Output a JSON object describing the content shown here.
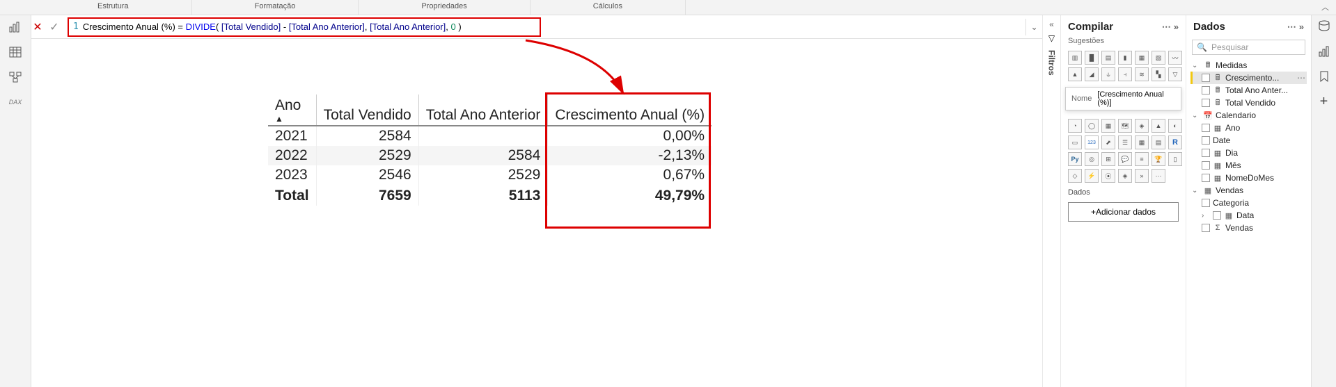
{
  "ribbon": {
    "tabs": [
      "Estrutura",
      "Formatação",
      "Propriedades",
      "Cálculos"
    ]
  },
  "formula": {
    "line_no": "1",
    "measure_name": "Crescimento Anual (%)",
    "eq": " = ",
    "fn": "DIVIDE",
    "open": "( ",
    "col1": "[Total Vendido]",
    "minus": " - ",
    "col2": "[Total Ano Anterior]",
    "comma1": ", ",
    "col3": "[Total Ano Anterior]",
    "comma2": ", ",
    "zero": "0",
    "close": " )"
  },
  "chart_data": {
    "type": "table",
    "columns": [
      "Ano",
      "Total Vendido",
      "Total Ano Anterior",
      "Crescimento Anual (%)"
    ],
    "rows": [
      {
        "ano": "2021",
        "vendido": "2584",
        "anterior": "",
        "cresc": "0,00%"
      },
      {
        "ano": "2022",
        "vendido": "2529",
        "anterior": "2584",
        "cresc": "-2,13%"
      },
      {
        "ano": "2023",
        "vendido": "2546",
        "anterior": "2529",
        "cresc": "0,67%"
      }
    ],
    "total": {
      "ano": "Total",
      "vendido": "7659",
      "anterior": "5113",
      "cresc": "49,79%"
    }
  },
  "filters": {
    "label": "Filtros"
  },
  "viz_pane": {
    "title": "Compilar",
    "sub": "Sugestões",
    "tooltip_name": "Nome",
    "tooltip_val": "[Crescimento Anual (%)]",
    "data_label": "Dados",
    "add_data": "+Adicionar dados"
  },
  "data_pane": {
    "title": "Dados",
    "search_placeholder": "Pesquisar",
    "tables": {
      "medidas": "Medidas",
      "m1": "Crescimento...",
      "m2": "Total Ano Anter...",
      "m3": "Total Vendido",
      "calendario": "Calendario",
      "c1": "Ano",
      "c2": "Date",
      "c3": "Dia",
      "c4": "Mês",
      "c5": "NomeDoMes",
      "vendas": "Vendas",
      "v1": "Categoria",
      "v2": "Data",
      "v3": "Vendas"
    }
  }
}
